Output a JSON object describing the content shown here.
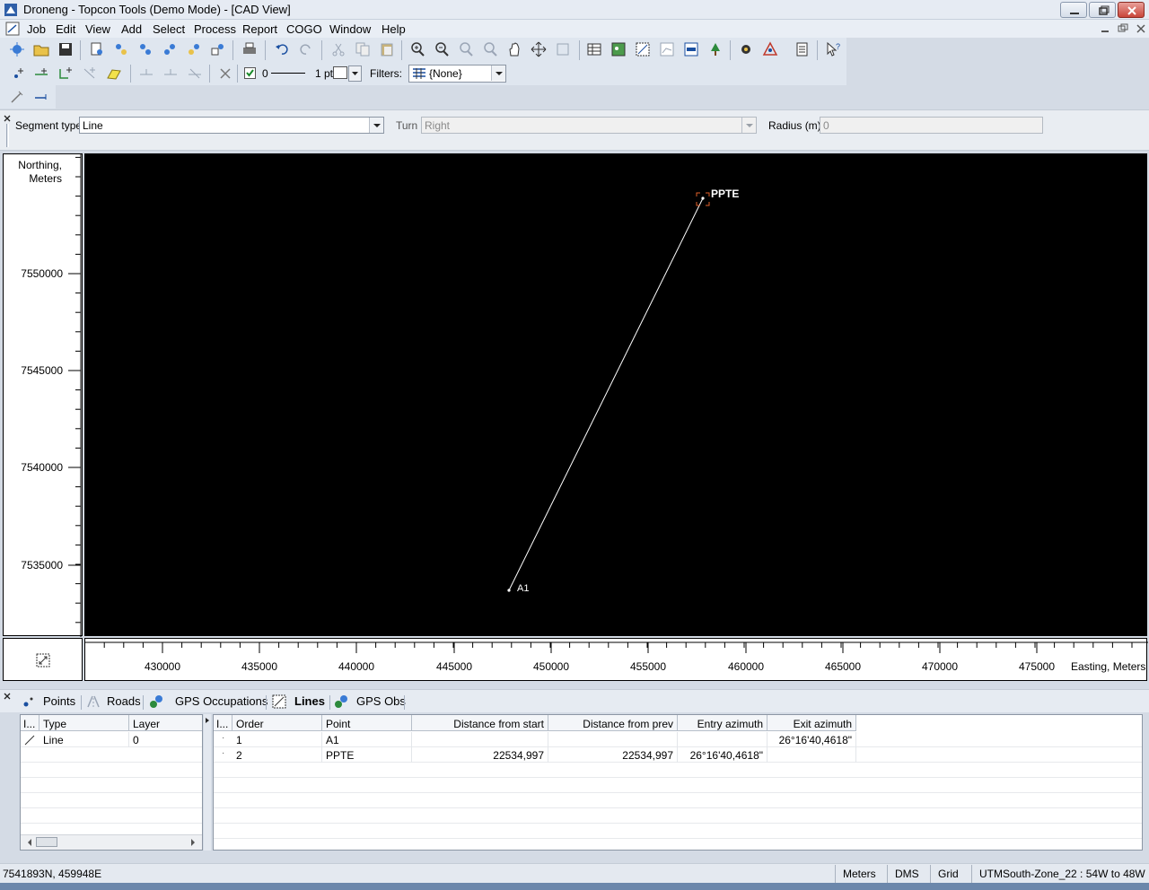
{
  "window": {
    "title": "Droneng - Topcon Tools (Demo Mode) - [CAD View]"
  },
  "menu": [
    "Job",
    "Edit",
    "View",
    "Add",
    "Select",
    "Process",
    "Report",
    "COGO",
    "Window",
    "Help"
  ],
  "style_toolbar": {
    "layer_value": "0",
    "line_width": "1 pt",
    "filters_label": "Filters:",
    "filter_value": "{None}",
    "checkbox_checked": true
  },
  "segment": {
    "type_label": "Segment type",
    "type_value": "Line",
    "turn_label": "Turn",
    "turn_value": "Right",
    "radius_label": "Radius (m)",
    "radius_value": "0"
  },
  "cad": {
    "y_axis_title": "Northing,",
    "y_axis_unit": "Meters",
    "x_axis_title": "Easting, Meters",
    "y_ticks": [
      "7550000",
      "7545000",
      "7540000",
      "7535000"
    ],
    "x_ticks": [
      "430000",
      "435000",
      "440000",
      "445000",
      "450000",
      "455000",
      "460000",
      "465000",
      "470000",
      "475000"
    ],
    "points": [
      {
        "name": "A1"
      },
      {
        "name": "PPTE"
      }
    ],
    "line_color": "#ffffff",
    "background": "#000000"
  },
  "tabs": [
    {
      "label": "Points",
      "icon": "points-icon",
      "active": false
    },
    {
      "label": "Roads",
      "icon": "roads-icon",
      "active": false
    },
    {
      "label": "GPS Occupations",
      "icon": "gps-occupations-icon",
      "active": false
    },
    {
      "label": "Lines",
      "icon": "lines-icon",
      "active": true
    },
    {
      "label": "GPS Obs",
      "icon": "gps-obs-icon",
      "active": false
    }
  ],
  "lines_table": {
    "columns": [
      "I...",
      "Type",
      "Layer"
    ],
    "rows": [
      {
        "type": "Line",
        "layer": "0"
      }
    ]
  },
  "segments_table": {
    "columns": [
      "I...",
      "Order",
      "Point",
      "Distance from start",
      "Distance from prev",
      "Entry azimuth",
      "Exit azimuth"
    ],
    "rows": [
      {
        "order": "1",
        "point": "A1",
        "dist_start": "",
        "dist_prev": "",
        "entry_az": "",
        "exit_az": "26°16'40,4618\""
      },
      {
        "order": "2",
        "point": "PPTE",
        "dist_start": "22534,997",
        "dist_prev": "22534,997",
        "entry_az": "26°16'40,4618\"",
        "exit_az": ""
      }
    ]
  },
  "status": {
    "cursor": "7541893N, 459948E",
    "units": "Meters",
    "angle_format": "DMS",
    "coord_type": "Grid",
    "zone": "UTMSouth-Zone_22 : 54W to 48W"
  }
}
